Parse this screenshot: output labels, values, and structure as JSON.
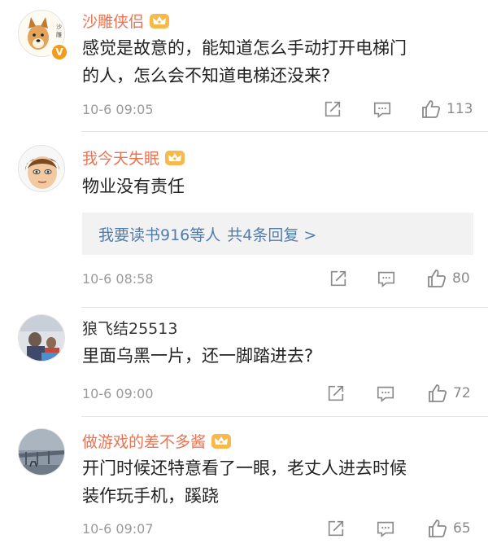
{
  "comments": [
    {
      "username": "沙雕侠侣",
      "text_lines": [
        "感觉是故意的，能知道怎么手动打开电梯门",
        "的人，怎么会不知道电梯还没来?"
      ],
      "time": "10-6 09:05",
      "likes": "113",
      "badge": "crown-icon",
      "verified": "V"
    },
    {
      "username": "我今天失眠",
      "text_lines": [
        "物业没有责任"
      ],
      "reply": {
        "user": "我要读书916等人",
        "summary": "共4条回复 >"
      },
      "time": "10-6 08:58",
      "likes": "80",
      "badge": "crown-icon"
    },
    {
      "username": "狼飞结25513",
      "text_lines": [
        "里面乌黑一片，还一脚踏进去?"
      ],
      "time": "10-6 09:00",
      "likes": "72"
    },
    {
      "username": "做游戏的差不多酱",
      "text_lines": [
        "开门时候还特意看了一眼，老丈人进去时候",
        "装作玩手机，蹊跷"
      ],
      "time": "10-6 09:07",
      "likes": "65",
      "badge": "crown-icon"
    }
  ],
  "colors": {
    "vip_name": "#eb7350",
    "link": "#507daf",
    "meta": "#9a9a9a",
    "icon": "#8a8a8a"
  }
}
